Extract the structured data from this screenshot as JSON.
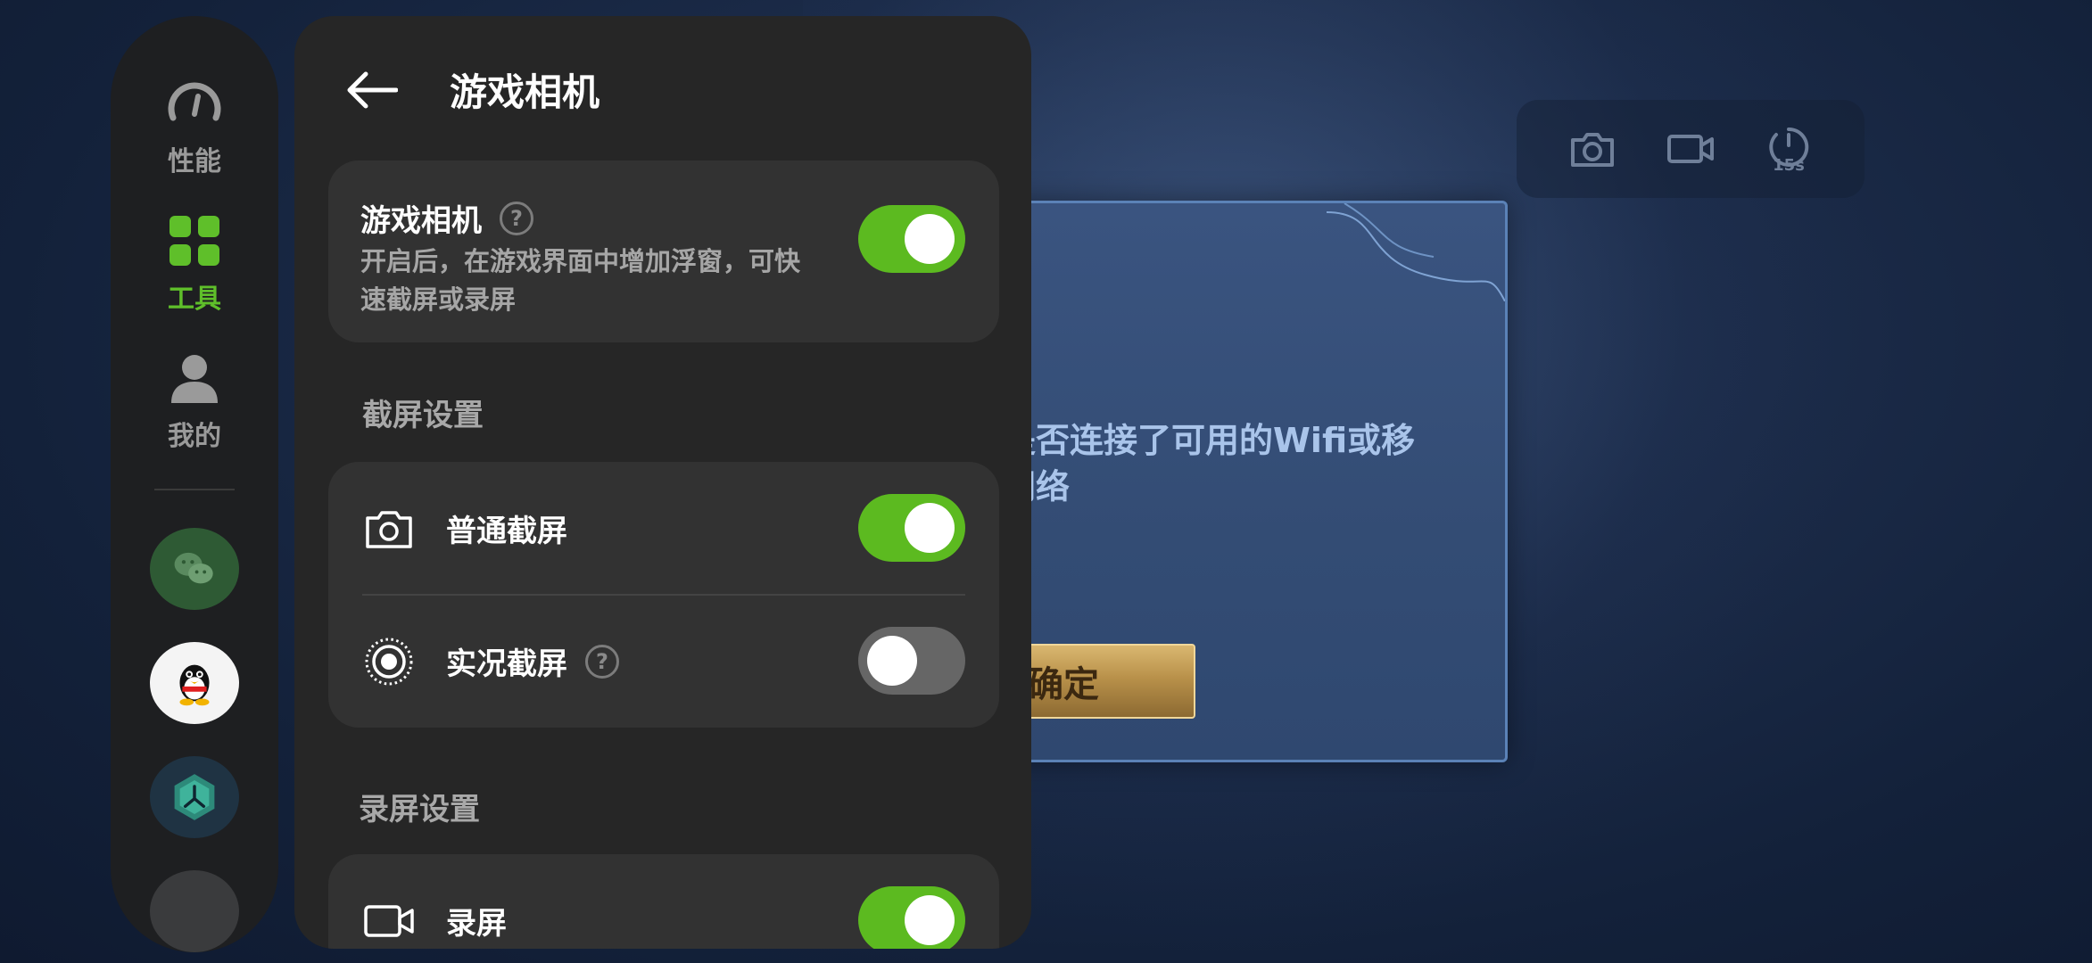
{
  "panel": {
    "title": "游戏相机",
    "main_card": {
      "title": "游戏相机",
      "description": "开启后，在游戏界面中增加浮窗，可快速截屏或录屏",
      "enabled": true
    },
    "screenshot_section": {
      "label": "截屏设置",
      "items": [
        {
          "label": "普通截屏",
          "enabled": true,
          "icon": "camera-icon"
        },
        {
          "label": "实况截屏",
          "enabled": false,
          "icon": "live-photo-icon"
        }
      ]
    },
    "record_section": {
      "label": "录屏设置",
      "items": [
        {
          "label": "录屏",
          "enabled": true,
          "icon": "video-camera-icon"
        }
      ]
    }
  },
  "rail": {
    "items": [
      {
        "label": "性能",
        "icon": "speedometer-icon",
        "active": false
      },
      {
        "label": "工具",
        "icon": "grid-icon",
        "active": true
      },
      {
        "label": "我的",
        "icon": "person-icon",
        "active": false
      }
    ],
    "apps": [
      "wechat-icon",
      "qq-icon",
      "app-icon"
    ]
  },
  "game": {
    "toolbar": {
      "timer_label": "15s"
    },
    "dialog_text": "是否连接了可用的Wifi或移\n网络",
    "confirm_label": "确定"
  },
  "colors": {
    "accent_green": "#5cba20",
    "panel_bg": "#262626",
    "card_bg": "#323232",
    "rail_bg": "#1e1f21"
  }
}
